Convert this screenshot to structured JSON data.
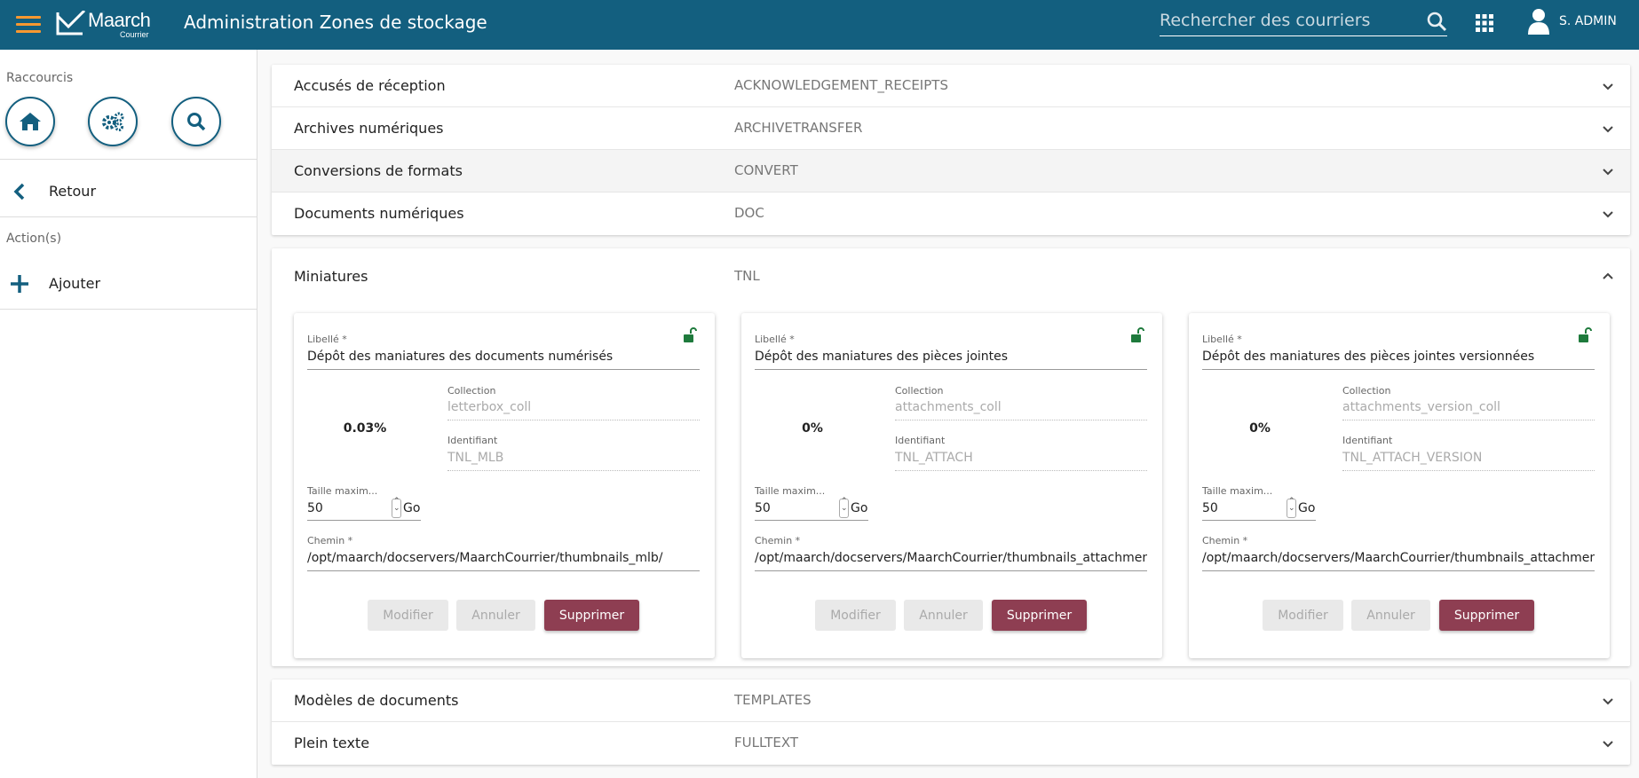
{
  "header": {
    "app_name": "Maarch",
    "app_sub": "Courrier",
    "title": "Administration Zones de stockage",
    "search_placeholder": "Rechercher des courriers",
    "user": "S. ADMIN",
    "colors": {
      "primary": "#135f7f",
      "accent": "#f99830"
    }
  },
  "sidebar": {
    "shortcuts_label": "Raccourcis",
    "shortcuts": [
      {
        "icon": "home-icon"
      },
      {
        "icon": "gears-icon"
      },
      {
        "icon": "search-icon"
      }
    ],
    "back_label": "Retour",
    "actions_label": "Action(s)",
    "add_label": "Ajouter"
  },
  "zones_top": [
    {
      "label": "Accusés de réception",
      "code": "ACKNOWLEDGEMENT_RECEIPTS"
    },
    {
      "label": "Archives numériques",
      "code": "ARCHIVETRANSFER"
    },
    {
      "label": "Conversions de formats",
      "code": "CONVERT"
    },
    {
      "label": "Documents numériques",
      "code": "DOC"
    }
  ],
  "expanded": {
    "label": "Miniatures",
    "code": "TNL",
    "field_labels": {
      "libelle": "Libellé *",
      "collection": "Collection",
      "identifiant": "Identifiant",
      "taille": "Taille maxim...",
      "chemin": "Chemin *",
      "unit": "Go"
    },
    "buttons": {
      "modify": "Modifier",
      "cancel": "Annuler",
      "delete": "Supprimer"
    },
    "colors": {
      "delete": "#8e3e52",
      "lock": "#1e7a3c"
    },
    "cards": [
      {
        "libelle": "Dépôt des maniatures des documents numérisés",
        "usage": "0.03%",
        "collection": "letterbox_coll",
        "identifiant": "TNL_MLB",
        "taille": "50",
        "chemin": "/opt/maarch/docservers/MaarchCourrier/thumbnails_mlb/"
      },
      {
        "libelle": "Dépôt des maniatures des pièces jointes",
        "usage": "0%",
        "collection": "attachments_coll",
        "identifiant": "TNL_ATTACH",
        "taille": "50",
        "chemin": "/opt/maarch/docservers/MaarchCourrier/thumbnails_attachments/"
      },
      {
        "libelle": "Dépôt des maniatures des pièces jointes versionnées",
        "usage": "0%",
        "collection": "attachments_version_coll",
        "identifiant": "TNL_ATTACH_VERSION",
        "taille": "50",
        "chemin": "/opt/maarch/docservers/MaarchCourrier/thumbnails_attachments_version/"
      }
    ]
  },
  "zones_bottom": [
    {
      "label": "Modèles de documents",
      "code": "TEMPLATES"
    },
    {
      "label": "Plein texte",
      "code": "FULLTEXT"
    }
  ]
}
